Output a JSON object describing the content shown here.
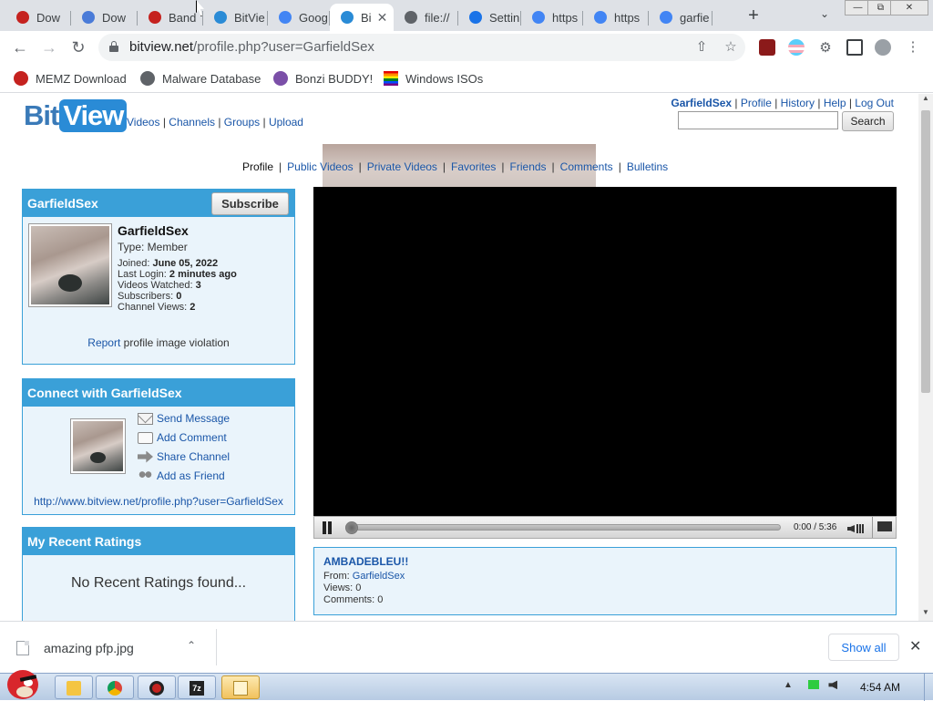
{
  "browser": {
    "tabs": [
      {
        "label": "Dow",
        "icon": "record-icon",
        "color": "#c5221f"
      },
      {
        "label": "Dow",
        "icon": "bonzi-icon",
        "color": "#4a7bd8"
      },
      {
        "label": "Band",
        "icon": "record-icon",
        "color": "#c5221f"
      },
      {
        "label": "BitVie",
        "icon": "bitview-icon",
        "color": "#2a8bd6"
      },
      {
        "label": "Goog",
        "icon": "google-icon",
        "color": "#4285f4"
      },
      {
        "label": "Bi",
        "icon": "bitview-icon",
        "color": "#2a8bd6",
        "active": true
      },
      {
        "label": "file://",
        "icon": "globe-icon",
        "color": "#5f6368"
      },
      {
        "label": "Settin",
        "icon": "gear-icon",
        "color": "#1a73e8"
      },
      {
        "label": "https",
        "icon": "google-icon",
        "color": "#4285f4"
      },
      {
        "label": "https",
        "icon": "google-icon",
        "color": "#4285f4"
      },
      {
        "label": "garfie",
        "icon": "google-icon",
        "color": "#4285f4"
      }
    ],
    "new_tab_glyph": "+",
    "url_host": "bitview.net",
    "url_path": "/profile.php?user=GarfieldSex",
    "bookmarks": [
      {
        "label": "MEMZ Download",
        "color": "#c5221f"
      },
      {
        "label": "Malware Database",
        "color": "#5f6368"
      },
      {
        "label": "Bonzi BUDDY!",
        "color": "#7b4fa8"
      },
      {
        "label": "Windows ISOs",
        "color": "#e05a2a"
      }
    ]
  },
  "site": {
    "logo_bit": "Bit",
    "logo_view": "View",
    "nav": [
      "Videos",
      "Channels",
      "Groups",
      "Upload"
    ],
    "user_links": [
      "GarfieldSex",
      "Profile",
      "History",
      "Help",
      "Log Out"
    ],
    "search_placeholder": "",
    "search_button": "Search",
    "subnav": {
      "current": "Profile",
      "links": [
        "Public Videos",
        "Private Videos",
        "Favorites",
        "Friends",
        "Comments",
        "Bulletins"
      ]
    }
  },
  "profile_box": {
    "header": "GarfieldSex",
    "subscribe": "Subscribe",
    "username": "GarfieldSex",
    "type": "Type: Member",
    "joined_label": "Joined:",
    "joined": "June 05, 2022",
    "last_login_label": "Last Login:",
    "last_login": "2 minutes ago",
    "videos_watched_label": "Videos Watched:",
    "videos_watched": "3",
    "subscribers_label": "Subscribers:",
    "subscribers": "0",
    "channel_views_label": "Channel Views:",
    "channel_views": "2",
    "report_link": "Report",
    "report_text": " profile image violation"
  },
  "connect_box": {
    "header": "Connect with GarfieldSex",
    "actions": [
      "Send Message",
      "Add Comment",
      "Share Channel",
      "Add as Friend"
    ],
    "profile_url": "http://www.bitview.net/profile.php?user=GarfieldSex"
  },
  "ratings_box": {
    "header": "My Recent Ratings",
    "empty": "No Recent Ratings found..."
  },
  "player": {
    "time": "0:00 / 5:36",
    "progress": 0
  },
  "video_info": {
    "title": "AMBADEBLEU!!",
    "from_label": "From: ",
    "from": "GarfieldSex",
    "views": "Views: 0",
    "comments": "Comments: 0"
  },
  "download_bar": {
    "filename": "amazing pfp.jpg",
    "show_all": "Show all"
  },
  "taskbar": {
    "time": "4:54 AM"
  }
}
